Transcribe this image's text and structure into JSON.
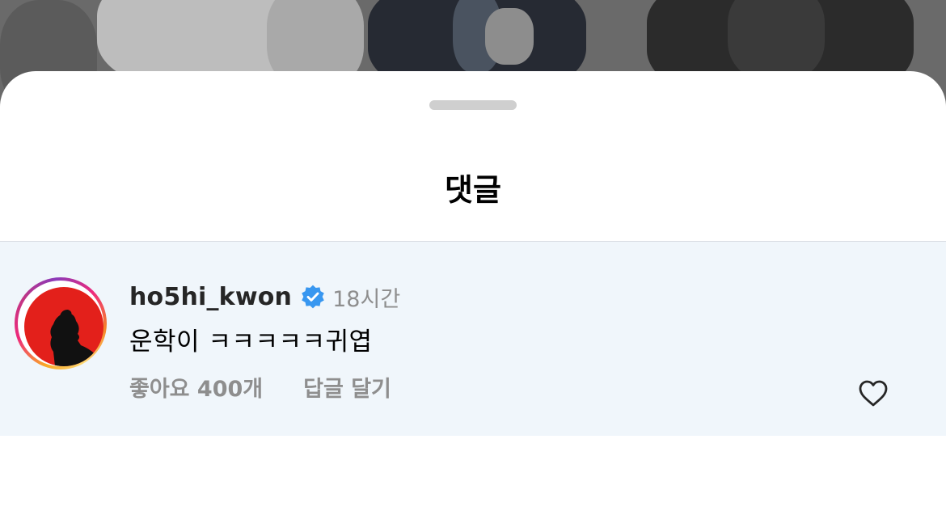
{
  "sheet": {
    "title": "댓글"
  },
  "comment": {
    "username": "ho5hi_kwon",
    "verified": true,
    "time": "18시간",
    "text": "운학이 ㅋㅋㅋㅋㅋ귀엽",
    "likes": "좋아요 400개",
    "reply_label": "답글 달기",
    "liked": false
  },
  "icons": {
    "verified": "verified-badge-icon",
    "like": "heart-outline-icon",
    "avatar": "profile-avatar"
  },
  "colors": {
    "highlight_row": "#f0f6fb",
    "verified_blue": "#3897f0",
    "avatar_bg": "#e3201b",
    "muted_text": "#8e8e8e"
  }
}
